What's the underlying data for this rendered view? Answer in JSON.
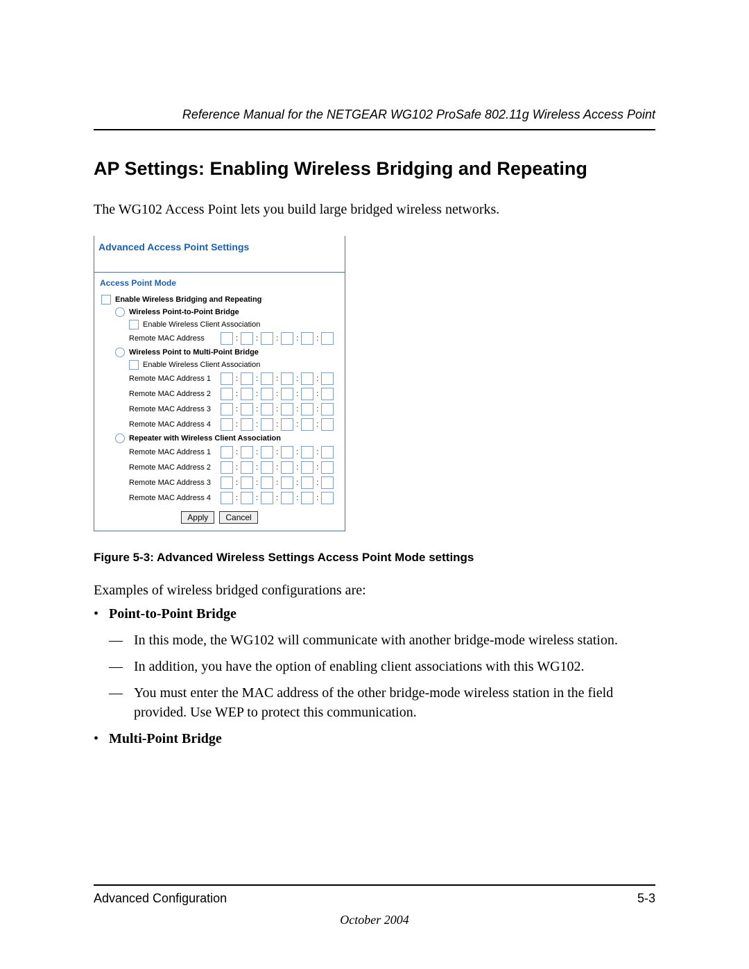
{
  "header": {
    "title": "Reference Manual for the NETGEAR WG102 ProSafe 802.11g Wireless Access Point"
  },
  "section": {
    "heading": "AP Settings: Enabling Wireless Bridging and Repeating",
    "intro": "The WG102 Access Point lets you build large bridged wireless networks."
  },
  "panel": {
    "title": "Advanced Access Point Settings",
    "mode_heading": "Access Point Mode",
    "enable_label": "Enable Wireless Bridging and Repeating",
    "modes": {
      "ptp": {
        "label": "Wireless Point-to-Point Bridge",
        "enable_client": "Enable Wireless Client Association",
        "mac_label": "Remote MAC Address"
      },
      "ptmp": {
        "label": "Wireless Point to Multi-Point Bridge",
        "enable_client": "Enable Wireless Client Association",
        "mac_labels": [
          "Remote MAC Address 1",
          "Remote MAC Address 2",
          "Remote MAC Address 3",
          "Remote MAC Address 4"
        ]
      },
      "repeater": {
        "label": "Repeater with Wireless Client Association",
        "mac_labels": [
          "Remote MAC Address 1",
          "Remote MAC Address 2",
          "Remote MAC Address 3",
          "Remote MAC Address 4"
        ]
      }
    },
    "buttons": {
      "apply": "Apply",
      "cancel": "Cancel"
    }
  },
  "figure_caption": "Figure 5-3:  Advanced Wireless Settings Access Point Mode settings",
  "examples": {
    "intro": "Examples of wireless bridged configurations are:",
    "ptp_heading": "Point-to-Point Bridge",
    "ptp_items": [
      "In this mode, the WG102 will communicate with another bridge-mode wireless station.",
      "In addition, you have the option of enabling client associations with this WG102.",
      "You must enter the MAC address of the other bridge-mode wireless station in the field provided. Use WEP to protect this communication."
    ],
    "mpb_heading": "Multi-Point Bridge"
  },
  "footer": {
    "left": "Advanced Configuration",
    "right": "5-3",
    "date": "October 2004"
  }
}
